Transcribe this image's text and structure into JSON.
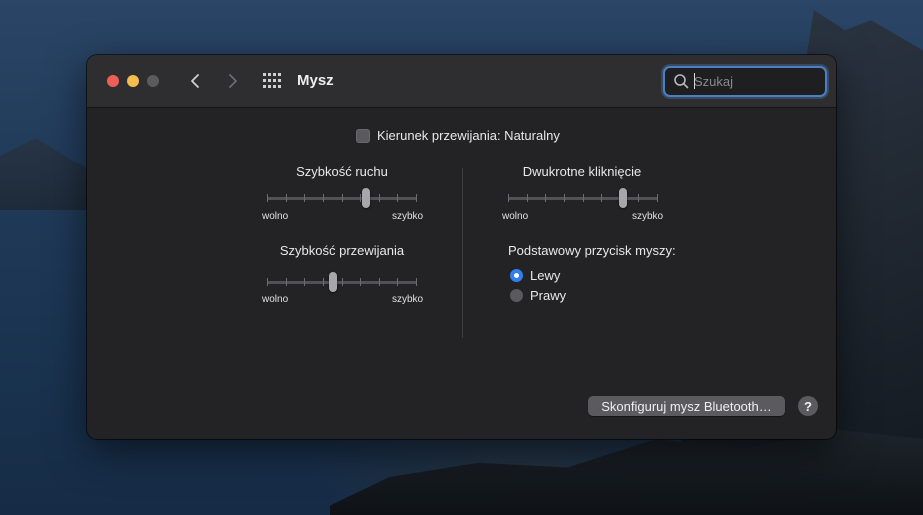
{
  "window": {
    "title": "Mysz",
    "search": {
      "placeholder": "Szukaj",
      "value": ""
    }
  },
  "natural_scroll": {
    "label": "Kierunek przewijania: Naturalny",
    "checked": false
  },
  "tracking_speed": {
    "label": "Szybkość ruchu",
    "min_label": "wolno",
    "max_label": "szybko",
    "level": 0.67
  },
  "scroll_speed": {
    "label": "Szybkość przewijania",
    "min_label": "wolno",
    "max_label": "szybko",
    "level": 0.44
  },
  "double_click": {
    "label": "Dwukrotne kliknięcie",
    "min_label": "wolno",
    "max_label": "szybko",
    "level": 0.78
  },
  "primary_button": {
    "label": "Podstawowy przycisk myszy:",
    "options": [
      "Lewy",
      "Prawy"
    ],
    "selected": "Lewy"
  },
  "footer": {
    "bluetooth_button": "Skonfiguruj mysz Bluetooth…",
    "help": "?"
  },
  "colors": {
    "accent": "#2f7ff0",
    "window_bg": "#232326",
    "titlebar_bg": "#2e2e31"
  },
  "icons": [
    "back-chevron-icon",
    "forward-chevron-icon",
    "grid-icon",
    "search-icon",
    "question-icon"
  ]
}
